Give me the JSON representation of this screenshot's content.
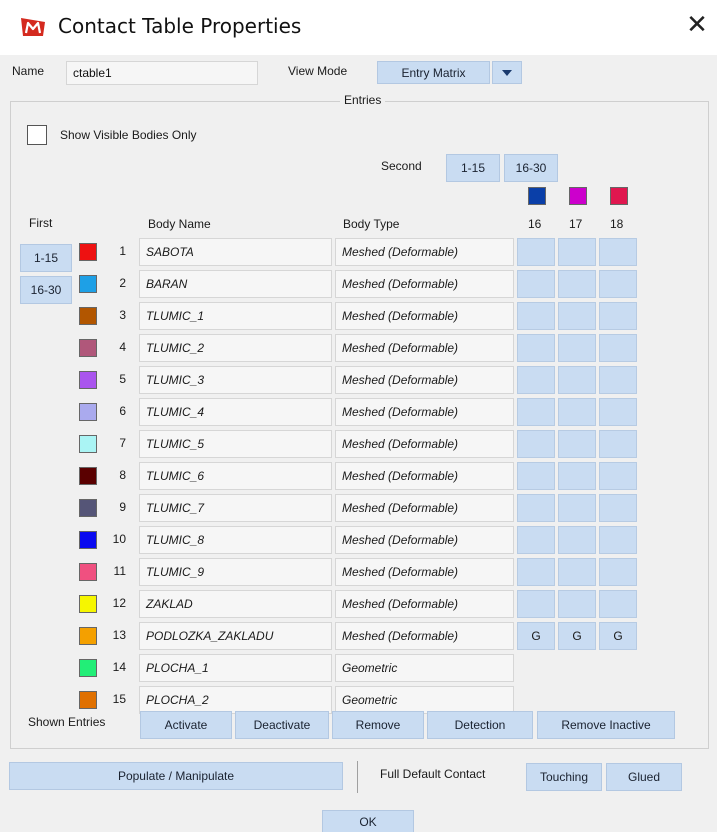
{
  "window": {
    "title": "Contact Table Properties",
    "close_glyph": "✕",
    "logo_icon": "marc-logo-icon"
  },
  "header": {
    "name_label": "Name",
    "name_value": "ctable1",
    "view_mode_label": "View Mode",
    "view_mode_value": "Entry Matrix"
  },
  "entries": {
    "group_title": "Entries",
    "show_visible_label": "Show Visible Bodies Only",
    "show_visible_checked": false,
    "second_label": "Second",
    "second_pages": [
      "1-15",
      "16-30"
    ],
    "first_label": "First",
    "first_pages": [
      "1-15",
      "16-30"
    ],
    "col_body_name": "Body Name",
    "col_body_type": "Body Type",
    "columns": [
      {
        "num": "16",
        "color": "#0a3fa8"
      },
      {
        "num": "17",
        "color": "#cc00cc"
      },
      {
        "num": "18",
        "color": "#e0174f"
      }
    ],
    "rows": [
      {
        "num": "1",
        "color": "#ee1111",
        "name": "SABOTA",
        "type": "Meshed (Deformable)",
        "cells": [
          "",
          "",
          ""
        ]
      },
      {
        "num": "2",
        "color": "#1ea0e6",
        "name": "BARAN",
        "type": "Meshed (Deformable)",
        "cells": [
          "",
          "",
          ""
        ]
      },
      {
        "num": "3",
        "color": "#b25600",
        "name": "TLUMIC_1",
        "type": "Meshed (Deformable)",
        "cells": [
          "",
          "",
          ""
        ]
      },
      {
        "num": "4",
        "color": "#b0577a",
        "name": "TLUMIC_2",
        "type": "Meshed (Deformable)",
        "cells": [
          "",
          "",
          ""
        ]
      },
      {
        "num": "5",
        "color": "#aa55ee",
        "name": "TLUMIC_3",
        "type": "Meshed (Deformable)",
        "cells": [
          "",
          "",
          ""
        ]
      },
      {
        "num": "6",
        "color": "#aaaaee",
        "name": "TLUMIC_4",
        "type": "Meshed (Deformable)",
        "cells": [
          "",
          "",
          ""
        ]
      },
      {
        "num": "7",
        "color": "#aaf4f4",
        "name": "TLUMIC_5",
        "type": "Meshed (Deformable)",
        "cells": [
          "",
          "",
          ""
        ]
      },
      {
        "num": "8",
        "color": "#5a0000",
        "name": "TLUMIC_6",
        "type": "Meshed (Deformable)",
        "cells": [
          "",
          "",
          ""
        ]
      },
      {
        "num": "9",
        "color": "#555577",
        "name": "TLUMIC_7",
        "type": "Meshed (Deformable)",
        "cells": [
          "",
          "",
          ""
        ]
      },
      {
        "num": "10",
        "color": "#0a0af0",
        "name": "TLUMIC_8",
        "type": "Meshed (Deformable)",
        "cells": [
          "",
          "",
          ""
        ]
      },
      {
        "num": "11",
        "color": "#f05080",
        "name": "TLUMIC_9",
        "type": "Meshed (Deformable)",
        "cells": [
          "",
          "",
          ""
        ]
      },
      {
        "num": "12",
        "color": "#f6f600",
        "name": "ZAKLAD",
        "type": "Meshed (Deformable)",
        "cells": [
          "",
          "",
          ""
        ]
      },
      {
        "num": "13",
        "color": "#f4a000",
        "name": "PODLOZKA_ZAKLADU",
        "type": "Meshed (Deformable)",
        "cells": [
          "G",
          "G",
          "G"
        ]
      },
      {
        "num": "14",
        "color": "#22ee77",
        "name": "PLOCHA_1",
        "type": "Geometric",
        "cells": null
      },
      {
        "num": "15",
        "color": "#e07000",
        "name": "PLOCHA_2",
        "type": "Geometric",
        "cells": null
      }
    ],
    "shown_entries_label": "Shown Entries",
    "actions": [
      "Activate",
      "Deactivate",
      "Remove",
      "Detection",
      "Remove Inactive"
    ]
  },
  "footer": {
    "populate_label": "Populate / Manipulate",
    "full_default_label": "Full Default Contact",
    "touching_label": "Touching",
    "glued_label": "Glued",
    "ok_label": "OK"
  }
}
